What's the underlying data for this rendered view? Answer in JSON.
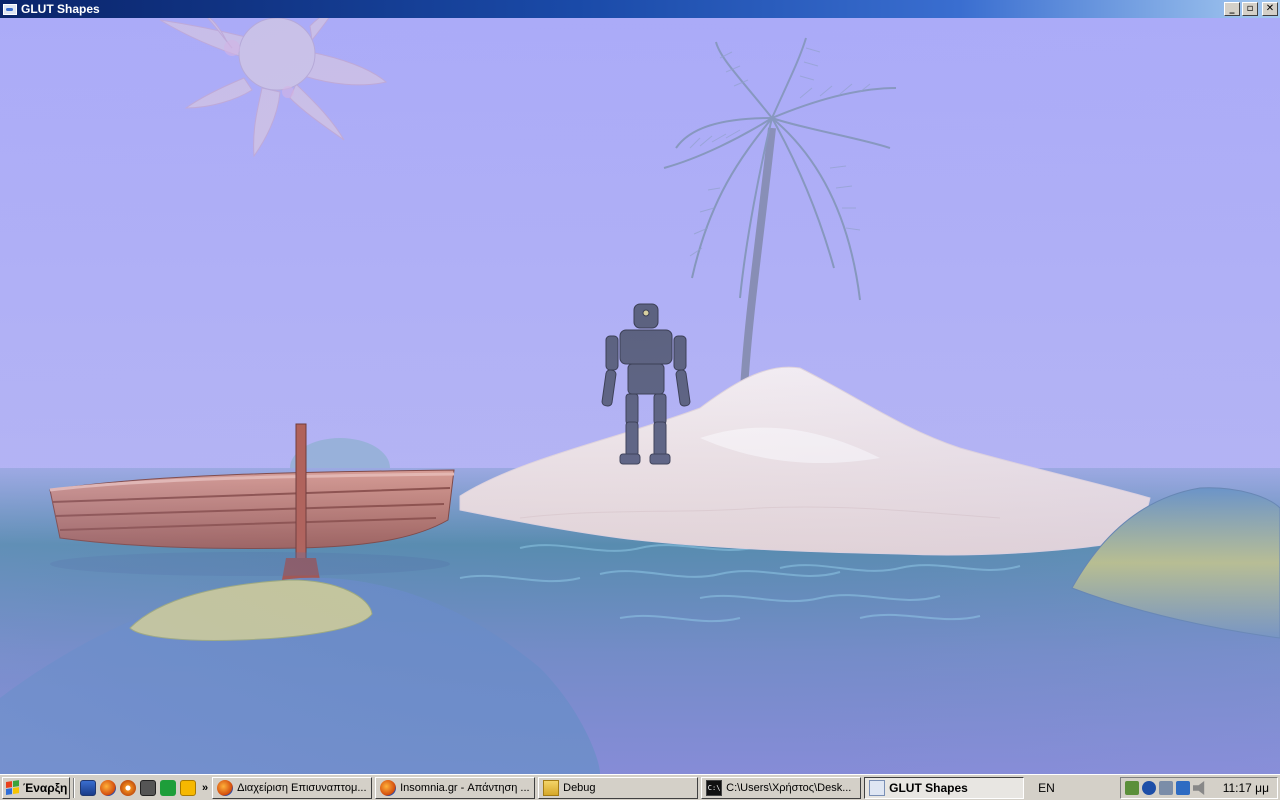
{
  "window": {
    "title": "GLUT Shapes",
    "controls": {
      "minimize": "_",
      "maximize": "▫",
      "close": "✕"
    }
  },
  "scene": {
    "sky_color": "#aeaef8",
    "water_color": "#5c8fb0",
    "sand_color": "#ece6ea",
    "boat_color": "#b86a5a",
    "robot_color": "#5a607a",
    "palm_color": "#7f8fae"
  },
  "taskbar": {
    "start_label": "Έναρξη",
    "quick_launch_chevron": "»",
    "tasks": [
      {
        "label": "Διαχείριση Επισυναπτομ...",
        "icon": "firefox-icon"
      },
      {
        "label": "Insomnia.gr - Απάντηση ...",
        "icon": "firefox-icon"
      },
      {
        "label": "Debug",
        "icon": "folder-icon"
      },
      {
        "label": "C:\\Users\\Χρήστος\\Desk...",
        "icon": "cmd-icon"
      },
      {
        "label": "GLUT Shapes",
        "icon": "glut-icon",
        "active": true
      }
    ],
    "language": "EN",
    "clock": "11:17 μμ"
  }
}
